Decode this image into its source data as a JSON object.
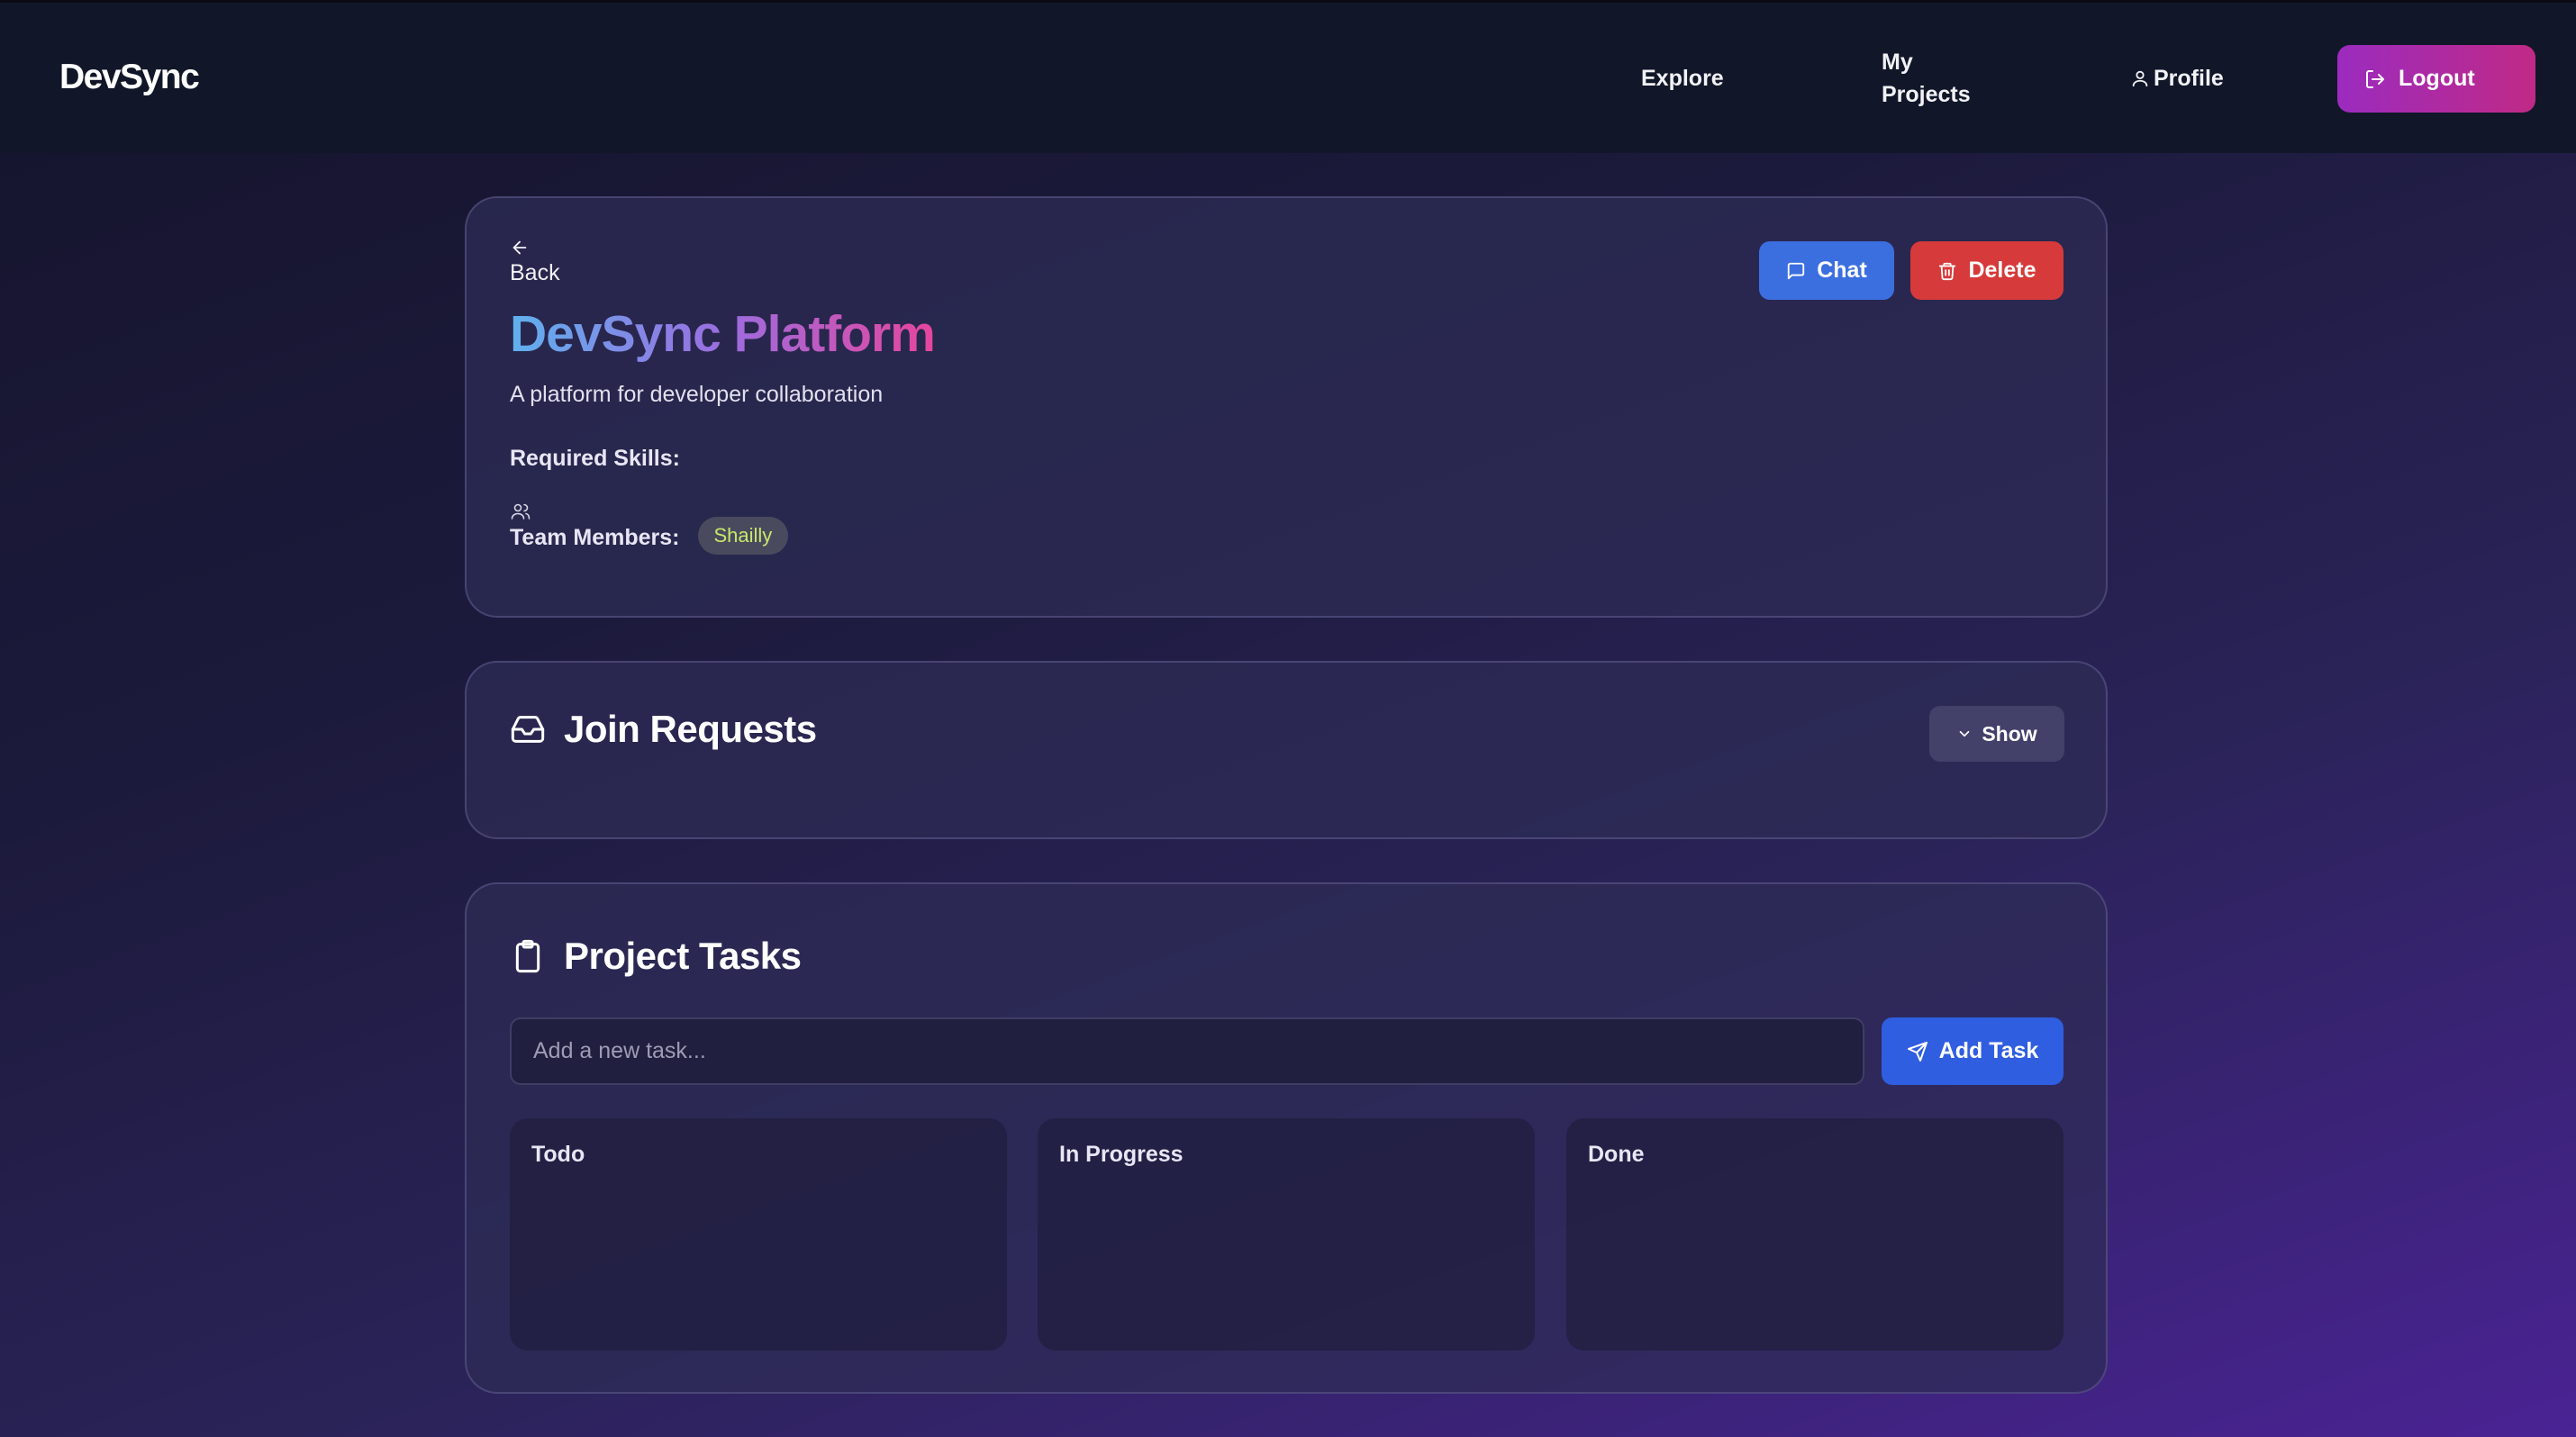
{
  "navbar": {
    "brand": "DevSync",
    "links": {
      "explore": "Explore",
      "my_projects": "My Projects",
      "profile": "Profile"
    },
    "logout_label": "Logout",
    "icons": {
      "profile": "user-icon",
      "logout": "logout-icon"
    },
    "logout_gradient": [
      "#9b2bbf",
      "#c02a86"
    ]
  },
  "project": {
    "back_label": "Back",
    "title_part1": "DevSync",
    "title_part2": "Platform",
    "description": "A platform for developer collaboration",
    "skills_label": "Required Skills:",
    "team_label": "Team Members:",
    "team_members": [
      "Shailly"
    ],
    "actions": {
      "chat": "Chat",
      "delete": "Delete"
    },
    "colors": {
      "chat": "#3b6fe0",
      "delete": "#d63a3a"
    }
  },
  "join_requests": {
    "title": "Join Requests",
    "toggle_label": "Show",
    "icon": "inbox-icon"
  },
  "tasks": {
    "title": "Project Tasks",
    "icon": "clipboard-icon",
    "input_placeholder": "Add a new task...",
    "input_value": "",
    "add_label": "Add Task",
    "columns": [
      "Todo",
      "In Progress",
      "Done"
    ]
  }
}
